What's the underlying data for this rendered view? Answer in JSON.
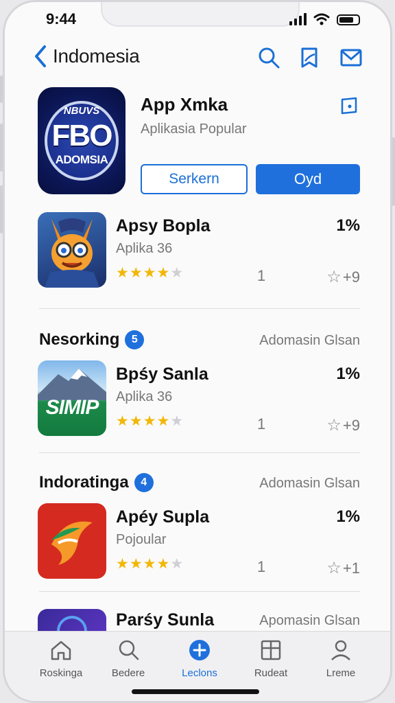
{
  "status": {
    "time": "9:44"
  },
  "nav": {
    "back_label": "Indomesia"
  },
  "hero": {
    "icon_text_top": "NBUVS",
    "icon_text_main": "FBO",
    "icon_text_bottom": "ADOMSIA",
    "title": "App Xmka",
    "subtitle": "Aplikasia Popular",
    "secondary_button": "Serkern",
    "primary_button": "Oyd",
    "accent_color": "#1f70dc"
  },
  "apps": [
    {
      "title": "Apsy Bopla",
      "subtitle": "Aplika 36",
      "percent": "1%",
      "stars": 4,
      "count": "1",
      "rating": "+9"
    },
    {
      "title": "Bpśy Sanla",
      "subtitle": "Aplika 36",
      "percent": "1%",
      "stars": 4,
      "count": "1",
      "rating": "+9",
      "icon_text": "SIMIP"
    },
    {
      "title": "Apéy Supla",
      "subtitle": "Pojoular",
      "percent": "1%",
      "stars": 4,
      "count": "1",
      "rating": "+1"
    },
    {
      "title": "Parśy Sunla"
    }
  ],
  "sections": [
    {
      "name": "Nesorking",
      "badge": "5",
      "more": "Adomasin Glsan"
    },
    {
      "name": "Indoratinga",
      "badge": "4",
      "more": "Adomasin Glsan"
    },
    {
      "more": "Apomasin Glsan"
    }
  ],
  "tabs": [
    {
      "label": "Roskinga",
      "icon": "home-icon"
    },
    {
      "label": "Bedere",
      "icon": "search-icon"
    },
    {
      "label": "Leclons",
      "icon": "plus-icon"
    },
    {
      "label": "Rudeat",
      "icon": "grid-icon"
    },
    {
      "label": "Lreme",
      "icon": "person-icon"
    }
  ]
}
